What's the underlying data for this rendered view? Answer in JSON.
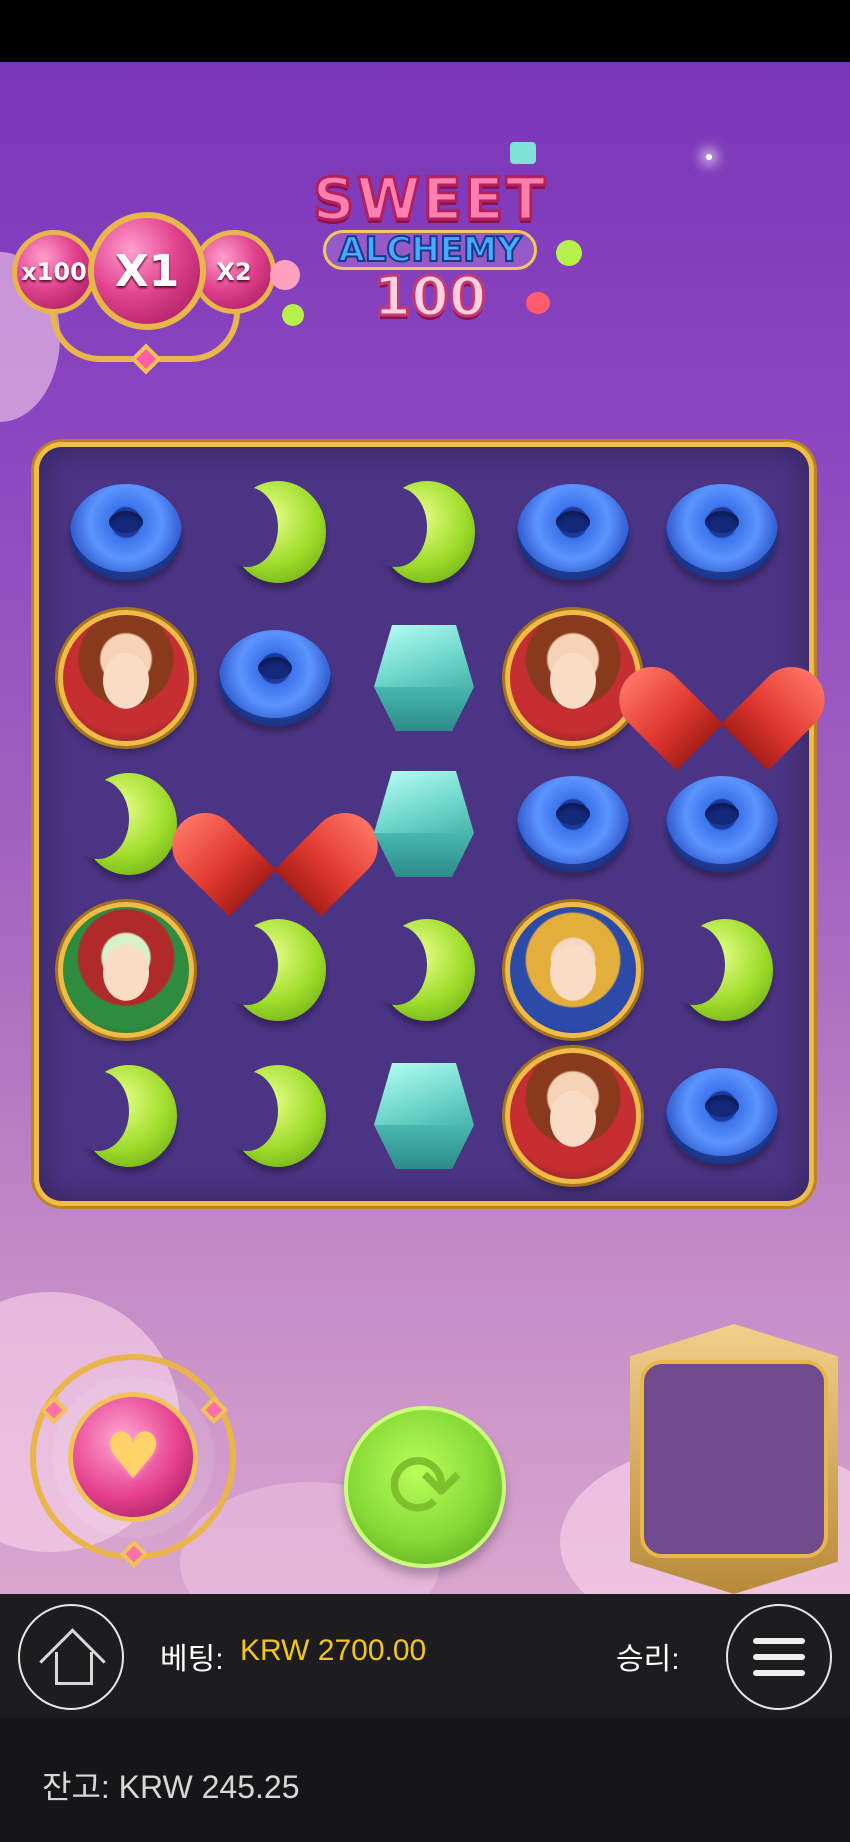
{
  "game": {
    "logo": {
      "line1": "SWEET",
      "line2": "ALCHEMY",
      "line3": "100"
    },
    "multipliers": {
      "left": "x100",
      "current": "X1",
      "right": "X2"
    },
    "grid": [
      [
        "donut",
        "bean",
        "bean",
        "donut",
        "donut"
      ],
      [
        "portrait-red",
        "donut",
        "gem",
        "portrait-red",
        "heart"
      ],
      [
        "bean",
        "heart",
        "gem",
        "donut",
        "donut"
      ],
      [
        "portrait-green",
        "bean",
        "bean",
        "portrait-blue",
        "bean"
      ],
      [
        "bean",
        "bean",
        "gem",
        "portrait-red",
        "donut"
      ]
    ],
    "colors": {
      "frame": "#f0bc48",
      "grid_bg": "#4b3484",
      "spin": "#86d936",
      "bet_value": "#f5c518"
    }
  },
  "controls": {
    "special_icon": "heart-icon",
    "spin_icon": "refresh-icon",
    "home_icon": "home-icon",
    "menu_icon": "hamburger-menu-icon"
  },
  "bottom_bar": {
    "bet_label": "베팅:",
    "bet_value": "KRW 2700.00",
    "win_label": "승리:"
  },
  "balance": {
    "text": "잔고: KRW 245.25"
  }
}
